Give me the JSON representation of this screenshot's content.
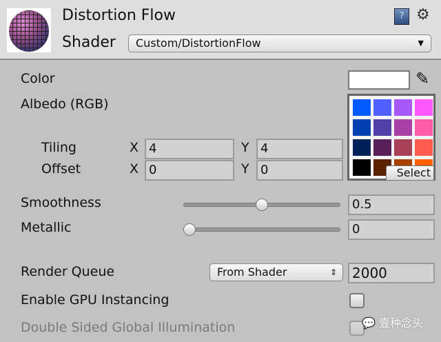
{
  "header": {
    "title": "Distortion Flow",
    "shader_label": "Shader",
    "shader_value": "Custom/DistortionFlow"
  },
  "properties": {
    "color_label": "Color",
    "albedo_label": "Albedo (RGB)",
    "select_label": "Select",
    "tiling": {
      "label": "Tiling",
      "x_label": "X",
      "x": "4",
      "y_label": "Y",
      "y": "4"
    },
    "offset": {
      "label": "Offset",
      "x_label": "X",
      "x": "0",
      "y_label": "Y",
      "y": "0"
    },
    "smoothness": {
      "label": "Smoothness",
      "value": "0.5",
      "fraction": 0.5
    },
    "metallic": {
      "label": "Metallic",
      "value": "0",
      "fraction": 0
    }
  },
  "advanced": {
    "render_queue_label": "Render Queue",
    "render_queue_mode": "From Shader",
    "render_queue_value": "2000",
    "gpu_instancing_label": "Enable GPU Instancing",
    "gpu_instancing": false,
    "double_sided_gi_label": "Double Sided Global Illumination",
    "double_sided_gi": false
  },
  "swatches": [
    "#005cff",
    "#5060ff",
    "#a858f8",
    "#ff58ff",
    "#0040b0",
    "#5040a8",
    "#a840a8",
    "#ff5ca8",
    "#00205a",
    "#581f5a",
    "#a84058",
    "#ff5c50",
    "#000000",
    "#5a2000",
    "#a84000",
    "#ff6000"
  ],
  "watermark": "壹种念头"
}
